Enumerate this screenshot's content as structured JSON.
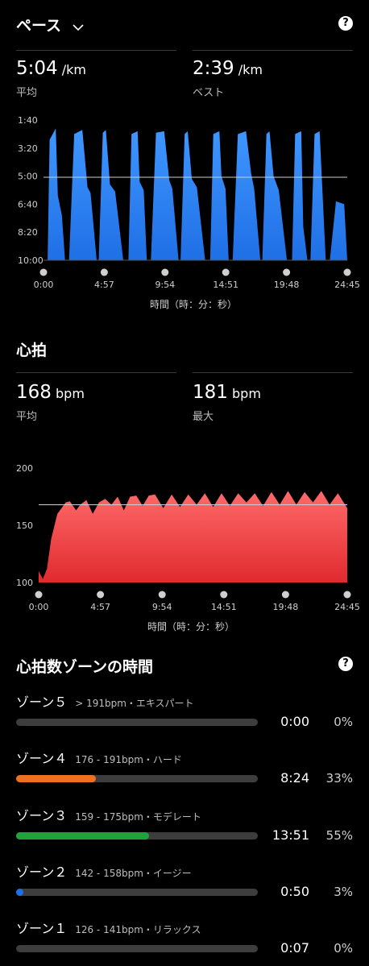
{
  "pace": {
    "title": "ペース",
    "avg_value": "5:04",
    "avg_unit": "/km",
    "avg_label": "平均",
    "best_value": "2:39",
    "best_unit": "/km",
    "best_label": "ベスト",
    "xlabel": "時間（時：分：秒）"
  },
  "heart": {
    "title": "心拍",
    "avg_value": "168",
    "avg_unit": "bpm",
    "avg_label": "平均",
    "max_value": "181",
    "max_unit": "bpm",
    "max_label": "最大",
    "xlabel": "時間（時：分：秒）"
  },
  "zones": {
    "title": "心拍数ゾーンの時間",
    "items": [
      {
        "name": "ゾーン５",
        "range": "> 191bpm・エキスパート",
        "time": "0:00",
        "pct": "0%",
        "fraction": 0,
        "color": "#3d3d3d"
      },
      {
        "name": "ゾーン４",
        "range": "176 - 191bpm・ハード",
        "time": "8:24",
        "pct": "33%",
        "fraction": 0.33,
        "color": "#f07020"
      },
      {
        "name": "ゾーン３",
        "range": "159 - 175bpm・モデレート",
        "time": "13:51",
        "pct": "55%",
        "fraction": 0.55,
        "color": "#22a23a"
      },
      {
        "name": "ゾーン２",
        "range": "142 - 158bpm・イージー",
        "time": "0:50",
        "pct": "3%",
        "fraction": 0.03,
        "color": "#1f6fe5"
      },
      {
        "name": "ゾーン１",
        "range": "126 - 141bpm・リラックス",
        "time": "0:07",
        "pct": "0%",
        "fraction": 0,
        "color": "#3d3d3d"
      }
    ]
  },
  "chart_data": [
    {
      "type": "area",
      "yticks": [
        "1:40",
        "3:20",
        "5:00",
        "6:40",
        "8:20",
        "10:00"
      ],
      "xticks": [
        "0:00",
        "4:57",
        "9:54",
        "14:51",
        "19:48",
        "24:45"
      ],
      "xlabel": "時間（時：分：秒）",
      "average_line": "5:04",
      "color": "#2f8cff",
      "x_seconds": [
        0,
        20,
        30,
        60,
        70,
        90,
        105,
        125,
        150,
        190,
        215,
        230,
        260,
        270,
        290,
        305,
        325,
        350,
        390,
        415,
        430,
        460,
        470,
        490,
        505,
        525,
        550,
        590,
        615,
        630,
        660,
        670,
        690,
        705,
        725,
        750,
        790,
        815,
        830,
        860,
        870,
        890,
        905,
        925,
        950,
        990,
        1015,
        1030,
        1060,
        1070,
        1090,
        1105,
        1125,
        1150,
        1190,
        1215,
        1230,
        1260,
        1270,
        1290,
        1305,
        1325,
        1350,
        1380,
        1400,
        1430,
        1470,
        1485
      ],
      "pace_seconds_per_km": [
        600,
        600,
        170,
        130,
        370,
        440,
        600,
        600,
        150,
        135,
        340,
        360,
        600,
        600,
        145,
        135,
        330,
        355,
        600,
        600,
        150,
        140,
        320,
        350,
        600,
        600,
        145,
        140,
        315,
        345,
        600,
        600,
        150,
        140,
        310,
        340,
        600,
        600,
        150,
        140,
        300,
        345,
        600,
        600,
        150,
        140,
        290,
        345,
        600,
        600,
        150,
        140,
        300,
        350,
        600,
        600,
        150,
        140,
        480,
        600,
        600,
        150,
        140,
        600,
        600,
        390,
        400,
        600
      ]
    },
    {
      "type": "area",
      "yticks": [
        "200",
        "150",
        "100"
      ],
      "xticks": [
        "0:00",
        "4:57",
        "9:54",
        "14:51",
        "19:48",
        "24:45"
      ],
      "xlabel": "時間（時：分：秒）",
      "average_line": 168,
      "color": "#e8363a",
      "x_seconds": [
        0,
        20,
        40,
        60,
        90,
        110,
        130,
        150,
        180,
        200,
        230,
        260,
        290,
        320,
        350,
        380,
        410,
        440,
        470,
        500,
        530,
        560,
        600,
        640,
        680,
        720,
        760,
        800,
        840,
        880,
        920,
        960,
        1000,
        1040,
        1080,
        1120,
        1160,
        1200,
        1240,
        1280,
        1320,
        1360,
        1400,
        1440,
        1485
      ],
      "bpm": [
        110,
        103,
        112,
        138,
        160,
        165,
        170,
        171,
        163,
        168,
        172,
        160,
        170,
        173,
        168,
        175,
        163,
        175,
        176,
        167,
        176,
        177,
        165,
        177,
        166,
        177,
        168,
        178,
        166,
        178,
        167,
        178,
        170,
        178,
        167,
        179,
        168,
        180,
        168,
        179,
        170,
        180,
        168,
        178,
        165
      ]
    }
  ]
}
